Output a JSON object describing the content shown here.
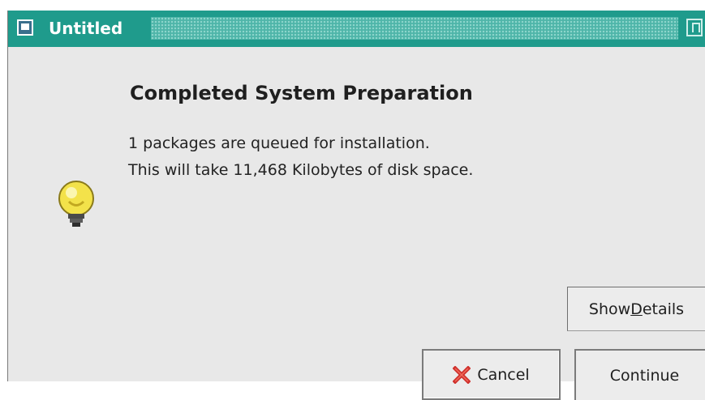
{
  "window": {
    "title": "Untitled"
  },
  "dialog": {
    "heading": "Completed System Preparation",
    "line1": "1 packages are queued for installation.",
    "line2": "This will take 11,468 Kilobytes of disk space."
  },
  "buttons": {
    "show_details_label_pre": "Show ",
    "show_details_label_ul": "D",
    "show_details_label_post": "etails",
    "cancel_label": "Cancel",
    "continue_label": "Continue"
  },
  "icons": {
    "title": "window-icon",
    "info": "lightbulb-icon",
    "cancel": "red-x-icon",
    "maximize": "maximize-icon"
  },
  "colors": {
    "titlebar": "#1f9b8c",
    "cancel_icon": "#d0312d",
    "bulb": "#f3e24a"
  }
}
